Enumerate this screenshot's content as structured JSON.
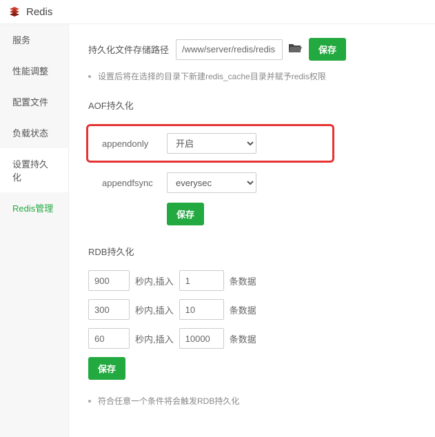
{
  "header": {
    "title": "Redis"
  },
  "sidebar": {
    "items": [
      {
        "label": "服务"
      },
      {
        "label": "性能调整"
      },
      {
        "label": "配置文件"
      },
      {
        "label": "负载状态"
      },
      {
        "label": "设置持久化"
      },
      {
        "label": "Redis管理"
      }
    ]
  },
  "main": {
    "path_label": "持久化文件存储路径",
    "path_value": "/www/server/redis/redis",
    "save_label": "保存",
    "path_hint": "设置后将在选择的目录下新建redis_cache目录并赋予redis权限",
    "aof": {
      "title": "AOF持久化",
      "appendonly_label": "appendonly",
      "appendonly_value": "开启",
      "appendfsync_label": "appendfsync",
      "appendfsync_value": "everysec"
    },
    "rdb": {
      "title": "RDB持久化",
      "sec_suffix": "秒内,插入",
      "count_suffix": "条数据",
      "rows": [
        {
          "seconds": "900",
          "count": "1"
        },
        {
          "seconds": "300",
          "count": "10"
        },
        {
          "seconds": "60",
          "count": "10000"
        }
      ],
      "hint": "符合任意一个条件将会触发RDB持久化"
    }
  }
}
